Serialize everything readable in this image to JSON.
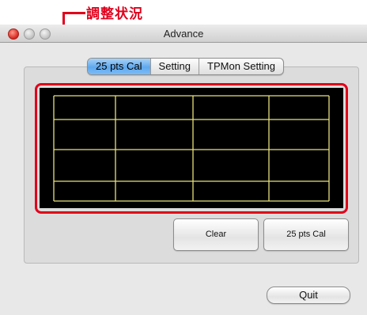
{
  "annotation": {
    "label": "調整状況",
    "color": "#e0001b"
  },
  "window": {
    "title": "Advance",
    "tabs": [
      {
        "label": "25 pts Cal",
        "active": true
      },
      {
        "label": "Setting",
        "active": false
      },
      {
        "label": "TPMon Setting",
        "active": false
      }
    ]
  },
  "calibration_display": {
    "background": "#000000",
    "line_color": "#e8e27a"
  },
  "buttons": {
    "clear_label": "Clear",
    "cal_label": "25 pts Cal",
    "quit_label": "Quit"
  }
}
